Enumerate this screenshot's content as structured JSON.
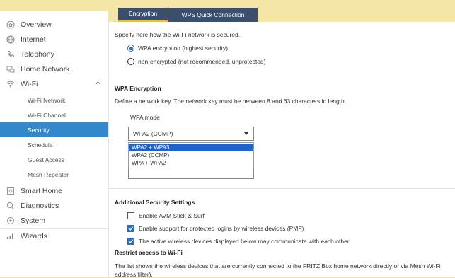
{
  "tabs": [
    {
      "label": "Encryption",
      "active": true
    },
    {
      "label": "WPS Quick Connection",
      "active": false
    }
  ],
  "sidebar": {
    "items": [
      {
        "label": "Overview",
        "icon": "home-icon"
      },
      {
        "label": "Internet",
        "icon": "globe-icon"
      },
      {
        "label": "Telephony",
        "icon": "phone-icon"
      },
      {
        "label": "Home Network",
        "icon": "network-icon"
      },
      {
        "label": "Wi-Fi",
        "icon": "wifi-icon",
        "expanded": true
      },
      {
        "label": "Smart Home",
        "icon": "smart-home-icon"
      },
      {
        "label": "Diagnostics",
        "icon": "diagnostics-icon"
      },
      {
        "label": "System",
        "icon": "system-icon"
      },
      {
        "label": "Wizards",
        "icon": "wizards-icon"
      }
    ],
    "wifi_sub": [
      {
        "label": "Wi-Fi Network",
        "active": false
      },
      {
        "label": "Wi-Fi Channel",
        "active": false
      },
      {
        "label": "Security",
        "active": true
      },
      {
        "label": "Schedule",
        "active": false
      },
      {
        "label": "Guest Access",
        "active": false
      },
      {
        "label": "Mesh Repeater",
        "active": false
      }
    ]
  },
  "content": {
    "intro": "Specify here how the Wi-Fi network is secured.",
    "radio_wpa": "WPA encryption (highest security)",
    "radio_none": "non-encrypted (not recommended, unprotected)",
    "wpa_heading": "WPA Encryption",
    "wpa_desc": "Define a network key. The network key must be between 8 and 63 characters in length.",
    "wpa_mode_label": "WPA mode",
    "wpa_mode_value": "WPA2 (CCMP)",
    "wpa_mode_options": [
      "WPA2 + WPA3",
      "WPA2 (CCMP)",
      "WPA + WPA2"
    ],
    "wpa_mode_highlighted": "WPA2 + WPA3",
    "additional_heading": "Additional Security Settings",
    "cb_avm": "Enable AVM Stick & Surf",
    "cb_pmf": "Enable support for protected logins by wireless devices (PMF)",
    "cb_communicate": "The active wireless devices displayed below may communicate with each other",
    "restrict_heading": "Restrict access to Wi-Fi",
    "restrict_desc_line1": "The list shows the wireless devices that are currently connected to the FRITZ!Box home network directly or via Mesh Wi-Fi",
    "restrict_desc_line2": "address filter)."
  },
  "state": {
    "radio_selected": "wpa",
    "cb_avm_checked": false,
    "cb_pmf_checked": true,
    "cb_communicate_checked": true
  },
  "colors": {
    "background": "#f5e6a6",
    "tab": "#3a4f6e",
    "tab_active_underline": "#f0c030",
    "sidebar_active": "#3388cc",
    "option_highlight": "#1e63c9",
    "checkbox_checked": "#2f6db5"
  }
}
